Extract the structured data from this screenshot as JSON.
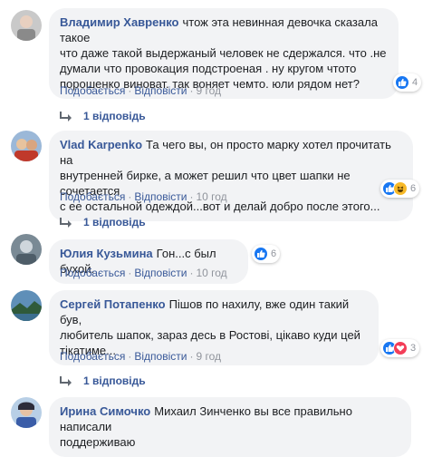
{
  "comments": [
    {
      "author": "Владимир Хавренко",
      "lines": [
        "чтож эта невинная девочка сказала такое",
        "что даже такой выдержаный человек не сдержался. что .не",
        "думали что провокация подстроеная . ну кругом чтото",
        "порошенко виноват. так воняет чемто. юли рядом нет?"
      ],
      "like": "Подобається",
      "reply": "Відповісти",
      "time": "9 год",
      "reaction_count": "4",
      "replies": "1 відповідь"
    },
    {
      "author": "Vlad Karpenko",
      "lines": [
        "Та чего вы, он просто марку хотел прочитать на",
        "внутренней бирке, а может решил что цвет шапки не сочетается",
        "с ее остальной одеждой...вот и делай добро после этого..."
      ],
      "like": "Подобається",
      "reply": "Відповісти",
      "time": "10 год",
      "reaction_count": "6",
      "replies": "1 відповідь"
    },
    {
      "author": "Юлия Кузьмина",
      "lines": [
        "Гон...с был бухой."
      ],
      "like": "Подобається",
      "reply": "Відповісти",
      "time": "10 год",
      "reaction_count": "6"
    },
    {
      "author": "Сергей Потапенко",
      "lines": [
        "Пішов по нахилу, вже один такий був,",
        "любитель шапок, зараз десь в Ростові, цікаво куди цей",
        "тікатиме..."
      ],
      "like": "Подобається",
      "reply": "Відповісти",
      "time": "9 год",
      "reaction_count": "3",
      "replies": "1 відповідь"
    },
    {
      "author": "Ирина Симочко",
      "lines": [
        "Михаил Зинченко вы все правильно написали",
        "поддерживаю"
      ]
    }
  ],
  "colors": {
    "link": "#385898",
    "meta": "#90949c",
    "bubble": "#f2f3f5",
    "like": "#1877f2",
    "love": "#f33e58",
    "haha": "#f7b928"
  },
  "icons": [
    "like-icon",
    "haha-icon",
    "love-icon",
    "reply-arrow-icon"
  ]
}
